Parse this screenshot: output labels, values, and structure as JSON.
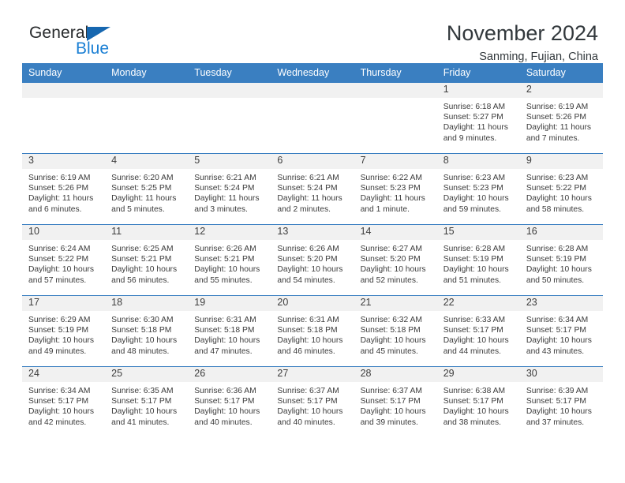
{
  "brand": {
    "name_part1": "General",
    "name_part2": "Blue",
    "triangle_icon": "triangle-icon",
    "color_dark": "#26292b",
    "color_blue": "#1a7fd4"
  },
  "header": {
    "title": "November 2024",
    "subtitle": "Sanming, Fujian, China"
  },
  "colors": {
    "header_blue": "#3a7fc1",
    "daynum_band": "#f1f1f1",
    "text": "#3b3b3b"
  },
  "weekday_headers": [
    "Sunday",
    "Monday",
    "Tuesday",
    "Wednesday",
    "Thursday",
    "Friday",
    "Saturday"
  ],
  "weeks": [
    [
      {
        "day": "",
        "sunrise": "",
        "sunset": "",
        "daylight": "",
        "empty": true
      },
      {
        "day": "",
        "sunrise": "",
        "sunset": "",
        "daylight": "",
        "empty": true
      },
      {
        "day": "",
        "sunrise": "",
        "sunset": "",
        "daylight": "",
        "empty": true
      },
      {
        "day": "",
        "sunrise": "",
        "sunset": "",
        "daylight": "",
        "empty": true
      },
      {
        "day": "",
        "sunrise": "",
        "sunset": "",
        "daylight": "",
        "empty": true
      },
      {
        "day": "1",
        "sunrise": "Sunrise: 6:18 AM",
        "sunset": "Sunset: 5:27 PM",
        "daylight": "Daylight: 11 hours and 9 minutes.",
        "empty": false
      },
      {
        "day": "2",
        "sunrise": "Sunrise: 6:19 AM",
        "sunset": "Sunset: 5:26 PM",
        "daylight": "Daylight: 11 hours and 7 minutes.",
        "empty": false
      }
    ],
    [
      {
        "day": "3",
        "sunrise": "Sunrise: 6:19 AM",
        "sunset": "Sunset: 5:26 PM",
        "daylight": "Daylight: 11 hours and 6 minutes.",
        "empty": false
      },
      {
        "day": "4",
        "sunrise": "Sunrise: 6:20 AM",
        "sunset": "Sunset: 5:25 PM",
        "daylight": "Daylight: 11 hours and 5 minutes.",
        "empty": false
      },
      {
        "day": "5",
        "sunrise": "Sunrise: 6:21 AM",
        "sunset": "Sunset: 5:24 PM",
        "daylight": "Daylight: 11 hours and 3 minutes.",
        "empty": false
      },
      {
        "day": "6",
        "sunrise": "Sunrise: 6:21 AM",
        "sunset": "Sunset: 5:24 PM",
        "daylight": "Daylight: 11 hours and 2 minutes.",
        "empty": false
      },
      {
        "day": "7",
        "sunrise": "Sunrise: 6:22 AM",
        "sunset": "Sunset: 5:23 PM",
        "daylight": "Daylight: 11 hours and 1 minute.",
        "empty": false
      },
      {
        "day": "8",
        "sunrise": "Sunrise: 6:23 AM",
        "sunset": "Sunset: 5:23 PM",
        "daylight": "Daylight: 10 hours and 59 minutes.",
        "empty": false
      },
      {
        "day": "9",
        "sunrise": "Sunrise: 6:23 AM",
        "sunset": "Sunset: 5:22 PM",
        "daylight": "Daylight: 10 hours and 58 minutes.",
        "empty": false
      }
    ],
    [
      {
        "day": "10",
        "sunrise": "Sunrise: 6:24 AM",
        "sunset": "Sunset: 5:22 PM",
        "daylight": "Daylight: 10 hours and 57 minutes.",
        "empty": false
      },
      {
        "day": "11",
        "sunrise": "Sunrise: 6:25 AM",
        "sunset": "Sunset: 5:21 PM",
        "daylight": "Daylight: 10 hours and 56 minutes.",
        "empty": false
      },
      {
        "day": "12",
        "sunrise": "Sunrise: 6:26 AM",
        "sunset": "Sunset: 5:21 PM",
        "daylight": "Daylight: 10 hours and 55 minutes.",
        "empty": false
      },
      {
        "day": "13",
        "sunrise": "Sunrise: 6:26 AM",
        "sunset": "Sunset: 5:20 PM",
        "daylight": "Daylight: 10 hours and 54 minutes.",
        "empty": false
      },
      {
        "day": "14",
        "sunrise": "Sunrise: 6:27 AM",
        "sunset": "Sunset: 5:20 PM",
        "daylight": "Daylight: 10 hours and 52 minutes.",
        "empty": false
      },
      {
        "day": "15",
        "sunrise": "Sunrise: 6:28 AM",
        "sunset": "Sunset: 5:19 PM",
        "daylight": "Daylight: 10 hours and 51 minutes.",
        "empty": false
      },
      {
        "day": "16",
        "sunrise": "Sunrise: 6:28 AM",
        "sunset": "Sunset: 5:19 PM",
        "daylight": "Daylight: 10 hours and 50 minutes.",
        "empty": false
      }
    ],
    [
      {
        "day": "17",
        "sunrise": "Sunrise: 6:29 AM",
        "sunset": "Sunset: 5:19 PM",
        "daylight": "Daylight: 10 hours and 49 minutes.",
        "empty": false
      },
      {
        "day": "18",
        "sunrise": "Sunrise: 6:30 AM",
        "sunset": "Sunset: 5:18 PM",
        "daylight": "Daylight: 10 hours and 48 minutes.",
        "empty": false
      },
      {
        "day": "19",
        "sunrise": "Sunrise: 6:31 AM",
        "sunset": "Sunset: 5:18 PM",
        "daylight": "Daylight: 10 hours and 47 minutes.",
        "empty": false
      },
      {
        "day": "20",
        "sunrise": "Sunrise: 6:31 AM",
        "sunset": "Sunset: 5:18 PM",
        "daylight": "Daylight: 10 hours and 46 minutes.",
        "empty": false
      },
      {
        "day": "21",
        "sunrise": "Sunrise: 6:32 AM",
        "sunset": "Sunset: 5:18 PM",
        "daylight": "Daylight: 10 hours and 45 minutes.",
        "empty": false
      },
      {
        "day": "22",
        "sunrise": "Sunrise: 6:33 AM",
        "sunset": "Sunset: 5:17 PM",
        "daylight": "Daylight: 10 hours and 44 minutes.",
        "empty": false
      },
      {
        "day": "23",
        "sunrise": "Sunrise: 6:34 AM",
        "sunset": "Sunset: 5:17 PM",
        "daylight": "Daylight: 10 hours and 43 minutes.",
        "empty": false
      }
    ],
    [
      {
        "day": "24",
        "sunrise": "Sunrise: 6:34 AM",
        "sunset": "Sunset: 5:17 PM",
        "daylight": "Daylight: 10 hours and 42 minutes.",
        "empty": false
      },
      {
        "day": "25",
        "sunrise": "Sunrise: 6:35 AM",
        "sunset": "Sunset: 5:17 PM",
        "daylight": "Daylight: 10 hours and 41 minutes.",
        "empty": false
      },
      {
        "day": "26",
        "sunrise": "Sunrise: 6:36 AM",
        "sunset": "Sunset: 5:17 PM",
        "daylight": "Daylight: 10 hours and 40 minutes.",
        "empty": false
      },
      {
        "day": "27",
        "sunrise": "Sunrise: 6:37 AM",
        "sunset": "Sunset: 5:17 PM",
        "daylight": "Daylight: 10 hours and 40 minutes.",
        "empty": false
      },
      {
        "day": "28",
        "sunrise": "Sunrise: 6:37 AM",
        "sunset": "Sunset: 5:17 PM",
        "daylight": "Daylight: 10 hours and 39 minutes.",
        "empty": false
      },
      {
        "day": "29",
        "sunrise": "Sunrise: 6:38 AM",
        "sunset": "Sunset: 5:17 PM",
        "daylight": "Daylight: 10 hours and 38 minutes.",
        "empty": false
      },
      {
        "day": "30",
        "sunrise": "Sunrise: 6:39 AM",
        "sunset": "Sunset: 5:17 PM",
        "daylight": "Daylight: 10 hours and 37 minutes.",
        "empty": false
      }
    ]
  ]
}
